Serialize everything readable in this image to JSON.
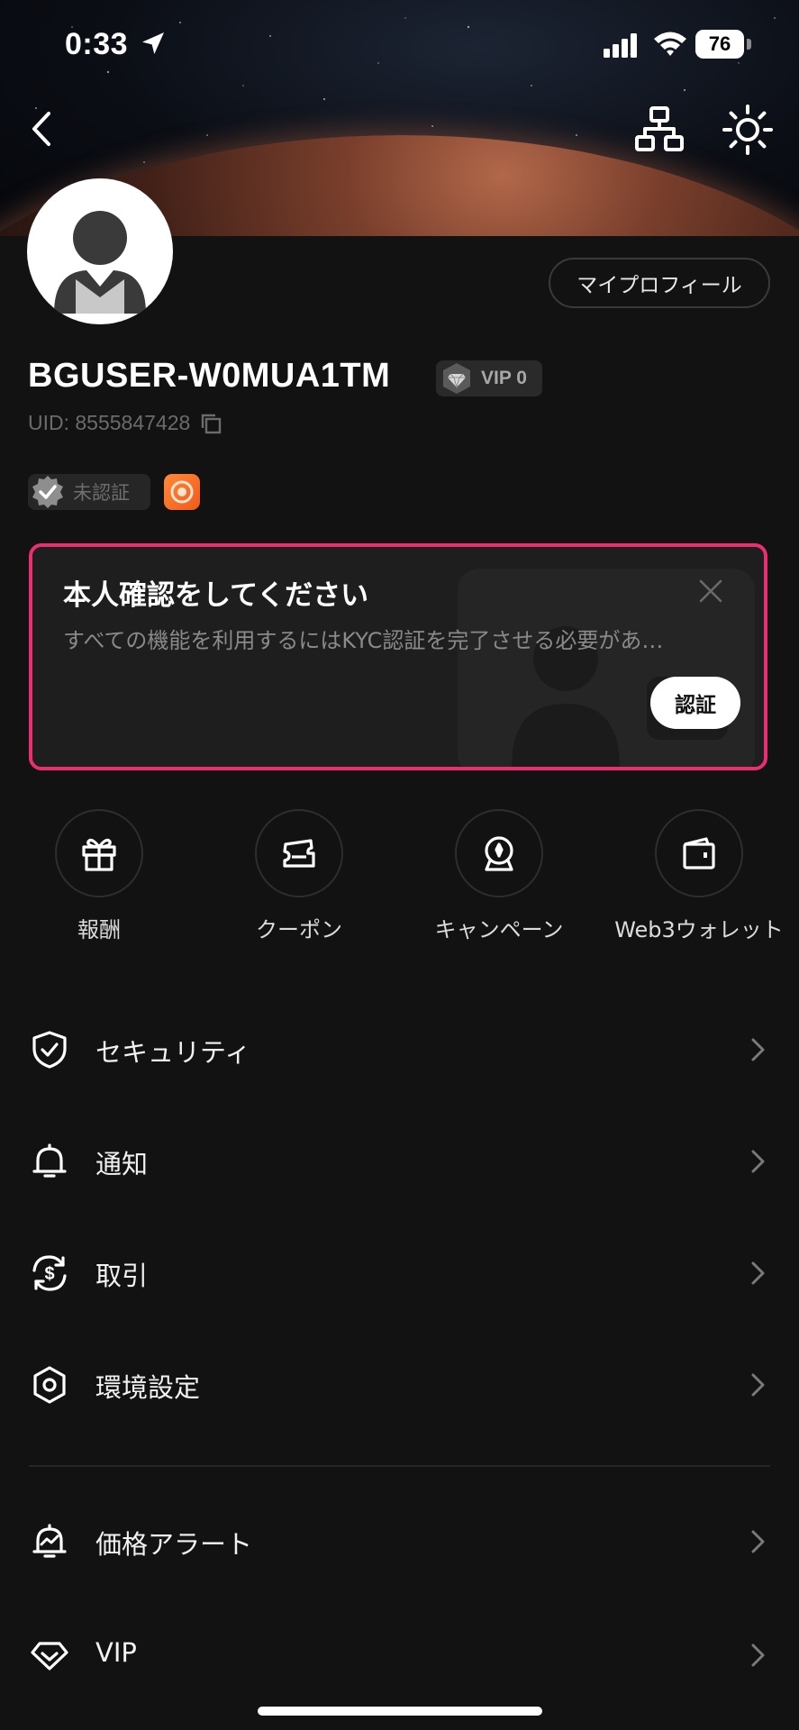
{
  "status_bar": {
    "time": "0:33",
    "battery": "76"
  },
  "profile": {
    "my_profile_label": "マイプロフィール",
    "username": "BGUSER-W0MUA1TM",
    "vip_label": "VIP 0",
    "uid": "UID: 8555847428",
    "verification_status": "未認証"
  },
  "kyc_banner": {
    "title": "本人確認をしてください",
    "description": "すべての機能を利用するにはKYC認証を完了させる必要があ…",
    "button_label": "認証"
  },
  "shortcuts": [
    {
      "label": "報酬",
      "icon": "gift-icon"
    },
    {
      "label": "クーポン",
      "icon": "coupon-icon"
    },
    {
      "label": "キャンペーン",
      "icon": "campaign-icon"
    },
    {
      "label": "Web3ウォレット",
      "icon": "wallet-icon"
    }
  ],
  "menu": [
    {
      "label": "セキュリティ",
      "icon": "shield-icon"
    },
    {
      "label": "通知",
      "icon": "bell-icon"
    },
    {
      "label": "取引",
      "icon": "dollar-exchange-icon"
    },
    {
      "label": "環境設定",
      "icon": "hexagon-settings-icon"
    },
    {
      "label": "価格アラート",
      "icon": "price-alert-icon"
    },
    {
      "label": "VIP",
      "icon": "diamond-icon"
    }
  ],
  "colors": {
    "background": "#121212",
    "kyc_border": "#ea2e71",
    "badge_orange": "#f26a26"
  }
}
